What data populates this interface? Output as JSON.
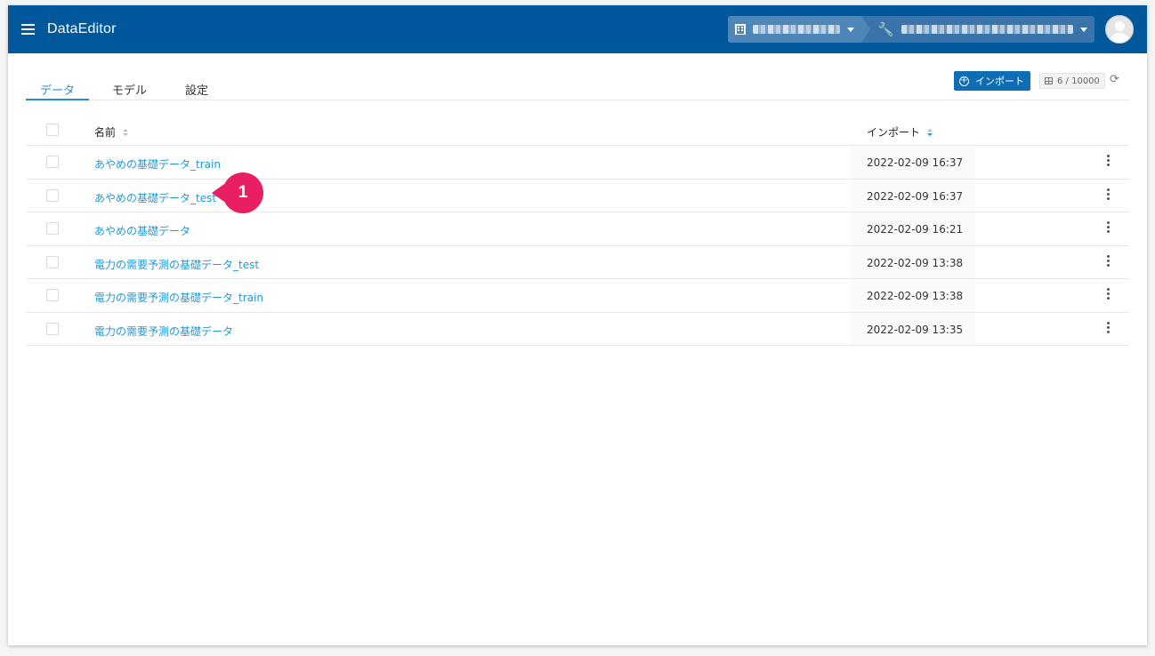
{
  "header": {
    "app_title": "DataEditor",
    "icons": {
      "menu": "hamburger-icon",
      "org": "building-icon",
      "project": "wrench-icon"
    }
  },
  "tabs": [
    {
      "label": "データ",
      "active": true
    },
    {
      "label": "モデル",
      "active": false
    },
    {
      "label": "設定",
      "active": false
    }
  ],
  "toolbar": {
    "import_label": "インポート",
    "count": "6 / 10000"
  },
  "table": {
    "columns": {
      "name": "名前",
      "import": "インポート"
    },
    "rows": [
      {
        "name": "あやめの基礎データ_train",
        "date": "2022-02-09 16:37"
      },
      {
        "name": "あやめの基礎データ_test",
        "date": "2022-02-09 16:37"
      },
      {
        "name": "あやめの基礎データ",
        "date": "2022-02-09 16:21"
      },
      {
        "name": "電力の需要予測の基礎データ_test",
        "date": "2022-02-09 13:38"
      },
      {
        "name": "電力の需要予測の基礎データ_train",
        "date": "2022-02-09 13:38"
      },
      {
        "name": "電力の需要予測の基礎データ",
        "date": "2022-02-09 13:35"
      }
    ]
  },
  "callout": {
    "number": "1"
  },
  "colors": {
    "header_bg": "#01579b",
    "link": "#1f9ad8",
    "accent": "#1f8fd4",
    "callout": "#e91e63"
  }
}
